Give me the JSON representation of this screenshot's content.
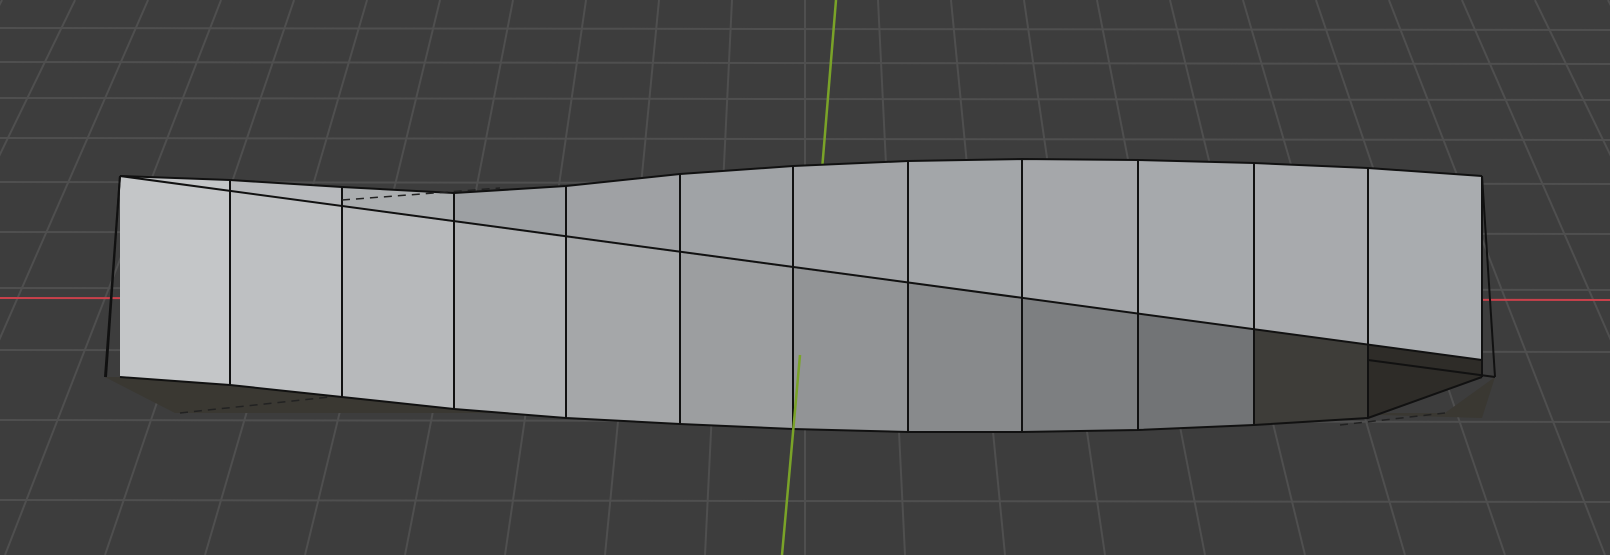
{
  "viewport": {
    "background": "#3d3d3d",
    "grid_color": "#4f4f4f",
    "x_axis_color": "#c9414b",
    "y_axis_color": "#7aa328"
  },
  "mesh": {
    "object": "twisted-strip",
    "segments": 12,
    "edge_color": "#111111",
    "front_light": "#c4c6c8",
    "front_dark": "#5c5e60",
    "back_light": "#9da0a3",
    "underside": "#3a3832"
  }
}
